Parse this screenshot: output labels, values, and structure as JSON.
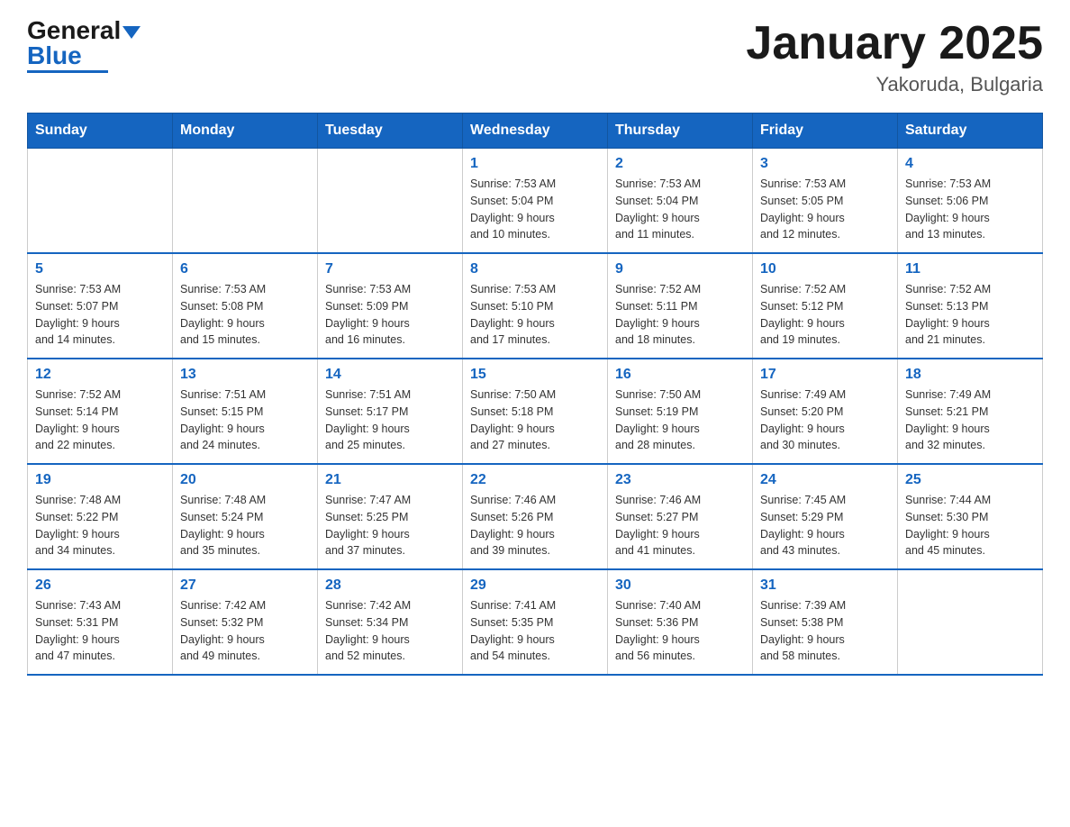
{
  "header": {
    "logo_general": "General",
    "logo_blue": "Blue",
    "title": "January 2025",
    "subtitle": "Yakoruda, Bulgaria"
  },
  "calendar": {
    "days_of_week": [
      "Sunday",
      "Monday",
      "Tuesday",
      "Wednesday",
      "Thursday",
      "Friday",
      "Saturday"
    ],
    "weeks": [
      [
        {
          "day": "",
          "info": ""
        },
        {
          "day": "",
          "info": ""
        },
        {
          "day": "",
          "info": ""
        },
        {
          "day": "1",
          "info": "Sunrise: 7:53 AM\nSunset: 5:04 PM\nDaylight: 9 hours\nand 10 minutes."
        },
        {
          "day": "2",
          "info": "Sunrise: 7:53 AM\nSunset: 5:04 PM\nDaylight: 9 hours\nand 11 minutes."
        },
        {
          "day": "3",
          "info": "Sunrise: 7:53 AM\nSunset: 5:05 PM\nDaylight: 9 hours\nand 12 minutes."
        },
        {
          "day": "4",
          "info": "Sunrise: 7:53 AM\nSunset: 5:06 PM\nDaylight: 9 hours\nand 13 minutes."
        }
      ],
      [
        {
          "day": "5",
          "info": "Sunrise: 7:53 AM\nSunset: 5:07 PM\nDaylight: 9 hours\nand 14 minutes."
        },
        {
          "day": "6",
          "info": "Sunrise: 7:53 AM\nSunset: 5:08 PM\nDaylight: 9 hours\nand 15 minutes."
        },
        {
          "day": "7",
          "info": "Sunrise: 7:53 AM\nSunset: 5:09 PM\nDaylight: 9 hours\nand 16 minutes."
        },
        {
          "day": "8",
          "info": "Sunrise: 7:53 AM\nSunset: 5:10 PM\nDaylight: 9 hours\nand 17 minutes."
        },
        {
          "day": "9",
          "info": "Sunrise: 7:52 AM\nSunset: 5:11 PM\nDaylight: 9 hours\nand 18 minutes."
        },
        {
          "day": "10",
          "info": "Sunrise: 7:52 AM\nSunset: 5:12 PM\nDaylight: 9 hours\nand 19 minutes."
        },
        {
          "day": "11",
          "info": "Sunrise: 7:52 AM\nSunset: 5:13 PM\nDaylight: 9 hours\nand 21 minutes."
        }
      ],
      [
        {
          "day": "12",
          "info": "Sunrise: 7:52 AM\nSunset: 5:14 PM\nDaylight: 9 hours\nand 22 minutes."
        },
        {
          "day": "13",
          "info": "Sunrise: 7:51 AM\nSunset: 5:15 PM\nDaylight: 9 hours\nand 24 minutes."
        },
        {
          "day": "14",
          "info": "Sunrise: 7:51 AM\nSunset: 5:17 PM\nDaylight: 9 hours\nand 25 minutes."
        },
        {
          "day": "15",
          "info": "Sunrise: 7:50 AM\nSunset: 5:18 PM\nDaylight: 9 hours\nand 27 minutes."
        },
        {
          "day": "16",
          "info": "Sunrise: 7:50 AM\nSunset: 5:19 PM\nDaylight: 9 hours\nand 28 minutes."
        },
        {
          "day": "17",
          "info": "Sunrise: 7:49 AM\nSunset: 5:20 PM\nDaylight: 9 hours\nand 30 minutes."
        },
        {
          "day": "18",
          "info": "Sunrise: 7:49 AM\nSunset: 5:21 PM\nDaylight: 9 hours\nand 32 minutes."
        }
      ],
      [
        {
          "day": "19",
          "info": "Sunrise: 7:48 AM\nSunset: 5:22 PM\nDaylight: 9 hours\nand 34 minutes."
        },
        {
          "day": "20",
          "info": "Sunrise: 7:48 AM\nSunset: 5:24 PM\nDaylight: 9 hours\nand 35 minutes."
        },
        {
          "day": "21",
          "info": "Sunrise: 7:47 AM\nSunset: 5:25 PM\nDaylight: 9 hours\nand 37 minutes."
        },
        {
          "day": "22",
          "info": "Sunrise: 7:46 AM\nSunset: 5:26 PM\nDaylight: 9 hours\nand 39 minutes."
        },
        {
          "day": "23",
          "info": "Sunrise: 7:46 AM\nSunset: 5:27 PM\nDaylight: 9 hours\nand 41 minutes."
        },
        {
          "day": "24",
          "info": "Sunrise: 7:45 AM\nSunset: 5:29 PM\nDaylight: 9 hours\nand 43 minutes."
        },
        {
          "day": "25",
          "info": "Sunrise: 7:44 AM\nSunset: 5:30 PM\nDaylight: 9 hours\nand 45 minutes."
        }
      ],
      [
        {
          "day": "26",
          "info": "Sunrise: 7:43 AM\nSunset: 5:31 PM\nDaylight: 9 hours\nand 47 minutes."
        },
        {
          "day": "27",
          "info": "Sunrise: 7:42 AM\nSunset: 5:32 PM\nDaylight: 9 hours\nand 49 minutes."
        },
        {
          "day": "28",
          "info": "Sunrise: 7:42 AM\nSunset: 5:34 PM\nDaylight: 9 hours\nand 52 minutes."
        },
        {
          "day": "29",
          "info": "Sunrise: 7:41 AM\nSunset: 5:35 PM\nDaylight: 9 hours\nand 54 minutes."
        },
        {
          "day": "30",
          "info": "Sunrise: 7:40 AM\nSunset: 5:36 PM\nDaylight: 9 hours\nand 56 minutes."
        },
        {
          "day": "31",
          "info": "Sunrise: 7:39 AM\nSunset: 5:38 PM\nDaylight: 9 hours\nand 58 minutes."
        },
        {
          "day": "",
          "info": ""
        }
      ]
    ]
  }
}
